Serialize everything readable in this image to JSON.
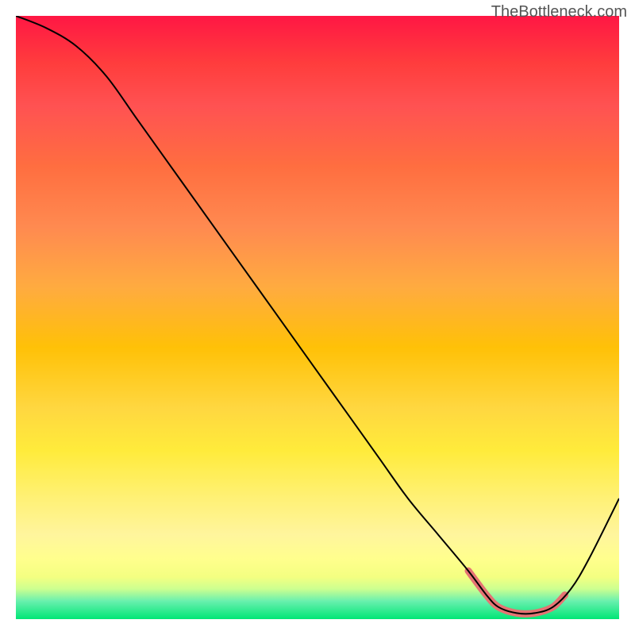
{
  "watermark": "TheBottleneck.com",
  "chart_data": {
    "type": "line",
    "title": "",
    "xlabel": "",
    "ylabel": "",
    "xlim": [
      0,
      100
    ],
    "ylim": [
      0,
      100
    ],
    "axes_visible": false,
    "gradient_background": {
      "top": "#ff1744",
      "mid_top": "#ff8a50",
      "mid": "#ffd740",
      "mid_bottom": "#fff176",
      "bottom": "#00e676"
    },
    "series": [
      {
        "name": "bottleneck-curve",
        "x": [
          0,
          5,
          10,
          15,
          20,
          25,
          30,
          35,
          40,
          45,
          50,
          55,
          60,
          65,
          70,
          75,
          78,
          80,
          83,
          86,
          89,
          92,
          95,
          100
        ],
        "y": [
          100,
          98,
          95,
          90,
          83,
          76,
          69,
          62,
          55,
          48,
          41,
          34,
          27,
          20,
          14,
          8,
          4,
          2,
          1,
          1,
          2,
          5,
          10,
          20
        ],
        "color": "#000000"
      },
      {
        "name": "optimal-range-highlight",
        "x": [
          75,
          78,
          80,
          83,
          86,
          89,
          91
        ],
        "y": [
          8,
          4,
          2,
          1,
          1,
          2,
          4
        ],
        "color": "#e57373"
      }
    ]
  }
}
